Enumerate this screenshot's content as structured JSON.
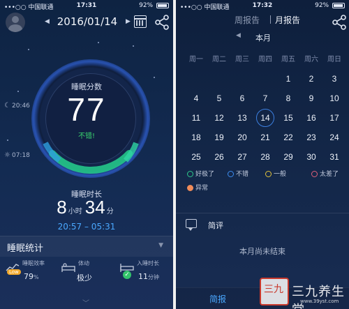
{
  "left": {
    "status": {
      "carrier": "•••○○ 中国联通",
      "time": "17:31",
      "battery": "92%"
    },
    "date": "2016/01/14",
    "score_label": "睡眠分数",
    "score": "77",
    "score_word": "不错!",
    "bedtime": "20:46",
    "wake_time": "07:18",
    "duration_label": "睡眠时长",
    "duration_hours": "8",
    "duration_hours_unit": "小时",
    "duration_minutes": "34",
    "duration_minutes_unit": "分",
    "duration_range": "20:57 – 05:31",
    "stats_title": "睡眠统计",
    "stats": [
      {
        "label": "睡眠效率",
        "value": "79",
        "unit": "%",
        "badge": "Low"
      },
      {
        "label": "体动",
        "value": "极少",
        "unit": ""
      },
      {
        "label": "入睡时长",
        "value": "11",
        "unit": "分钟"
      }
    ]
  },
  "right": {
    "status": {
      "carrier": "•••○○ 中国联通",
      "time": "17:32",
      "battery": "92%"
    },
    "tab_weekly": "周报告",
    "tab_monthly": "月报告",
    "month_label": "本月",
    "weekdays": [
      "周一",
      "周二",
      "周三",
      "周四",
      "周五",
      "周六",
      "周日"
    ],
    "today": "14",
    "days": [
      "1",
      "2",
      "3",
      "4",
      "5",
      "6",
      "7",
      "8",
      "9",
      "10",
      "11",
      "12",
      "13",
      "14",
      "15",
      "16",
      "17",
      "18",
      "19",
      "20",
      "21",
      "22",
      "23",
      "24",
      "25",
      "26",
      "27",
      "28",
      "29",
      "30",
      "31"
    ],
    "legend": [
      {
        "label": "好极了",
        "color": "#2ec98a"
      },
      {
        "label": "不错",
        "color": "#3c8cf0"
      },
      {
        "label": "一般",
        "color": "#e3c43c"
      },
      {
        "label": "太差了",
        "color": "#e0607a"
      },
      {
        "label": "异常",
        "color": "#f08c5a"
      }
    ],
    "comment_title": "简评",
    "comment_text": "本月尚未结束",
    "brief_label": "简报",
    "watermark": {
      "logo": "三九",
      "text": "三九养生堂",
      "url": "www.39yst.com"
    }
  }
}
